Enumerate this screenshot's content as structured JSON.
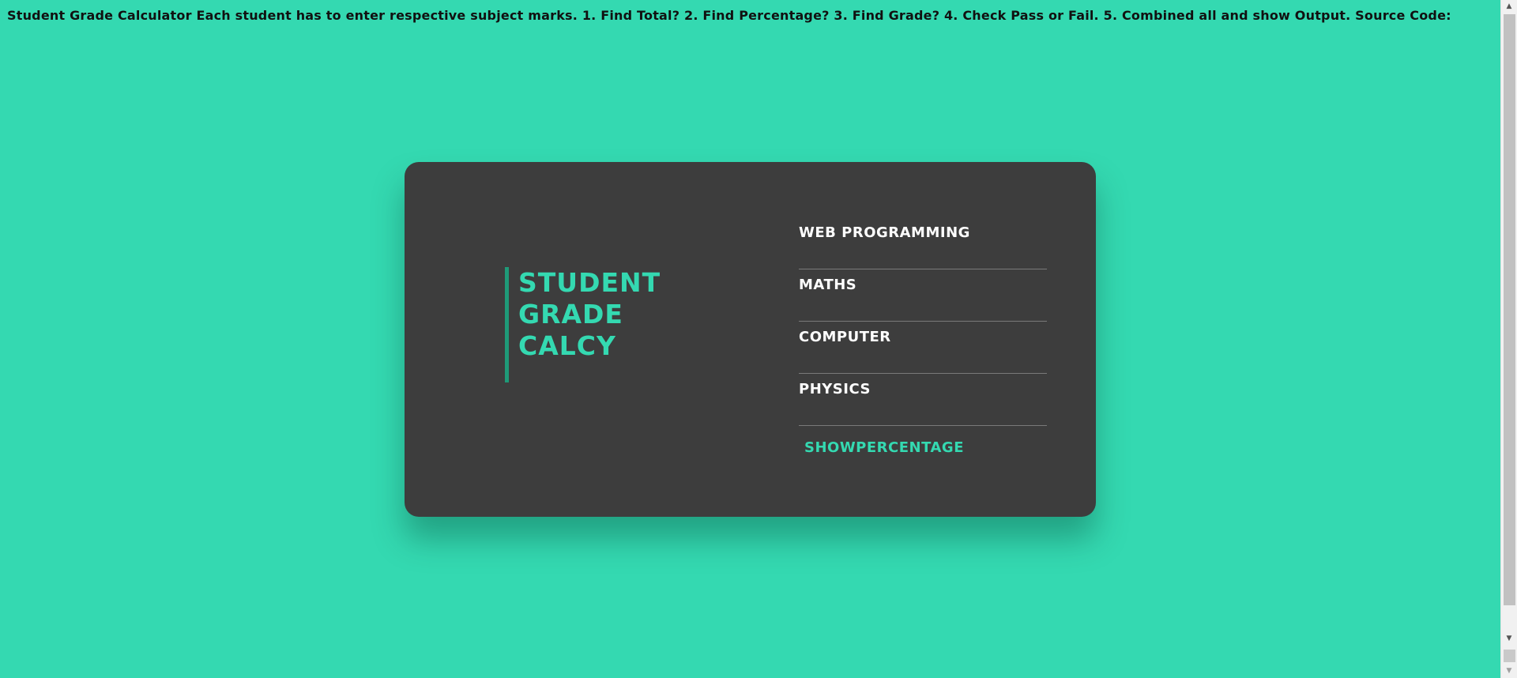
{
  "page": {
    "heading": "Student Grade Calculator Each student has to enter respective subject marks. 1. Find Total? 2. Find Percentage? 3. Find Grade? 4. Check Pass or Fail. 5. Combined all and show Output. Source Code:"
  },
  "card": {
    "brand_lines": [
      "STUDENT",
      "GRADE",
      "CALCY"
    ],
    "fields": [
      {
        "label": "WEB PROGRAMMING",
        "value": ""
      },
      {
        "label": "MATHS",
        "value": ""
      },
      {
        "label": "COMPUTER",
        "value": ""
      },
      {
        "label": "PHYSICS",
        "value": ""
      }
    ],
    "submit_label": "SHOWPERCENTAGE"
  },
  "colors": {
    "background": "#34d9b1",
    "card": "#3d3d3d",
    "accent": "#34d9b1",
    "brand_bar": "#1f9a78"
  },
  "icons": {
    "scroll_up": "triangle-up-icon",
    "scroll_down": "triangle-down-icon"
  }
}
